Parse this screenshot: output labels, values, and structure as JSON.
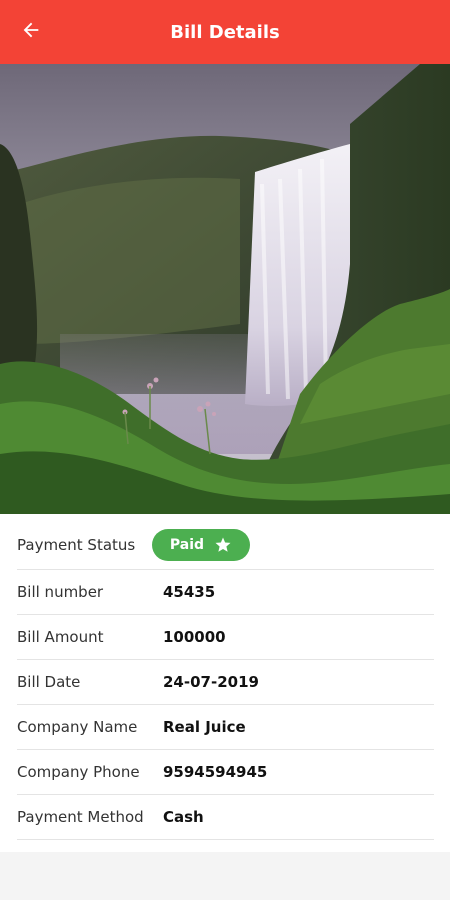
{
  "header": {
    "title": "Bill Details",
    "back_icon": "arrow-left-icon",
    "color": "#f34336"
  },
  "hero": {
    "image": "waterfall-photo"
  },
  "details": {
    "payment_status": {
      "label": "Payment Status",
      "value": "Paid",
      "icon": "star-icon",
      "color": "#4caf50"
    },
    "rows": [
      {
        "label": "Bill number",
        "value": "45435"
      },
      {
        "label": "Bill Amount",
        "value": "100000"
      },
      {
        "label": "Bill Date",
        "value": "24-07-2019"
      },
      {
        "label": "Company Name",
        "value": "Real Juice"
      },
      {
        "label": "Company Phone",
        "value": "9594594945"
      },
      {
        "label": "Payment Method",
        "value": "Cash"
      }
    ]
  }
}
